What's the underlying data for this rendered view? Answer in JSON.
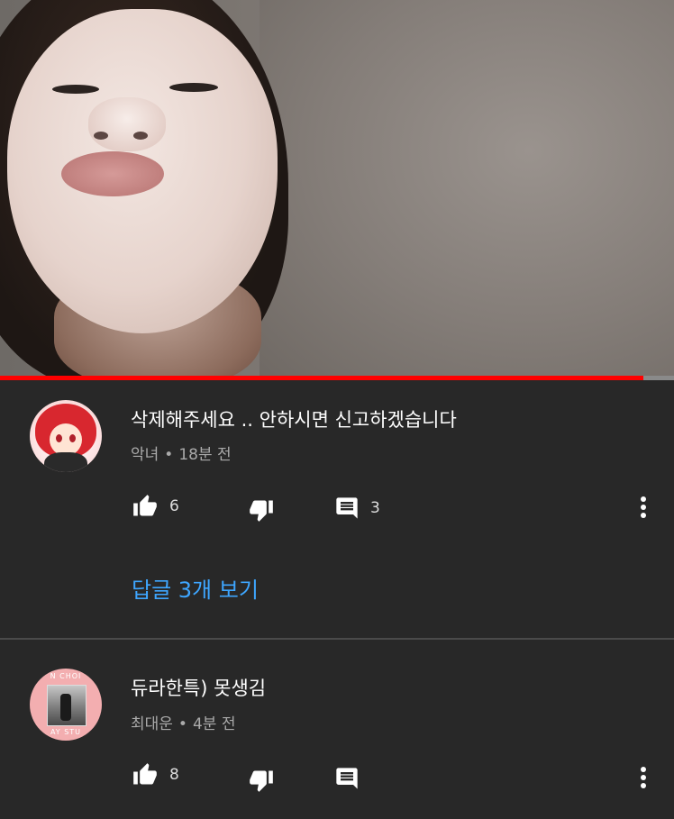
{
  "video": {
    "progress_fraction": 0.955
  },
  "comments": [
    {
      "text": "삭제해주세요 .. 안하시면 신고하겠습니다",
      "author": "악녀",
      "separator": "•",
      "time": "18분 전",
      "likes": "6",
      "replies_count": "3",
      "view_replies": "답글 3개 보기"
    },
    {
      "text": "듀라한특) 못생김",
      "author": "최대운",
      "separator": "•",
      "time": "4분 전",
      "likes": "8",
      "avatar_text_top": "N CHOI",
      "avatar_text_bottom": "AY STU"
    }
  ],
  "colors": {
    "background": "#282828",
    "progress": "#ff0000",
    "link": "#3ea6ff",
    "meta": "#aaaaaa"
  },
  "icons": [
    "thumbs-up-icon",
    "thumbs-down-icon",
    "reply-icon",
    "more-vert-icon"
  ]
}
